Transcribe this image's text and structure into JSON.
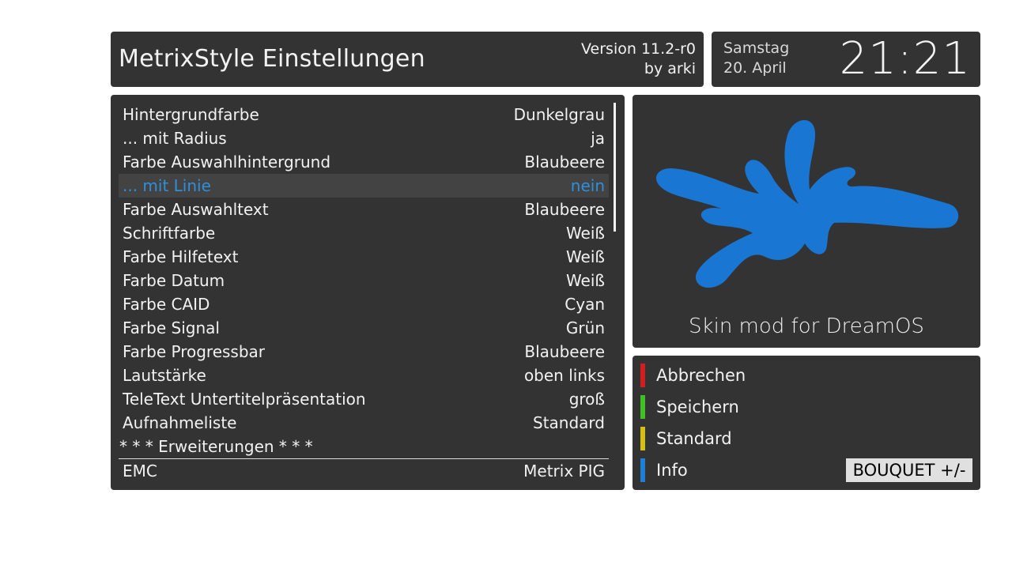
{
  "header": {
    "title": "MetrixStyle Einstellungen",
    "version": "Version 11.2-r0",
    "author": "by arki"
  },
  "clock": {
    "weekday": "Samstag",
    "date": "20. April",
    "time": "21:21"
  },
  "settings": [
    {
      "label": "Hintergrundfarbe",
      "value": "Dunkelgrau"
    },
    {
      "label": "... mit Radius",
      "value": "ja"
    },
    {
      "label": "Farbe Auswahlhintergrund",
      "value": "Blaubeere"
    },
    {
      "label": "... mit Linie",
      "value": "nein",
      "selected": true
    },
    {
      "label": "Farbe Auswahltext",
      "value": "Blaubeere"
    },
    {
      "label": "Schriftfarbe",
      "value": "Weiß"
    },
    {
      "label": "Farbe Hilfetext",
      "value": "Weiß"
    },
    {
      "label": "Farbe Datum",
      "value": "Weiß"
    },
    {
      "label": "Farbe CAID",
      "value": "Cyan"
    },
    {
      "label": "Farbe Signal",
      "value": "Grün"
    },
    {
      "label": "Farbe Progressbar",
      "value": "Blaubeere"
    },
    {
      "label": "Lautstärke",
      "value": "oben links"
    },
    {
      "label": "TeleText Untertitelpräsentation",
      "value": "groß"
    },
    {
      "label": "Aufnahmeliste",
      "value": "Standard"
    },
    {
      "label": "* * * Erweiterungen * * *",
      "value": "",
      "section": true
    },
    {
      "label": "EMC",
      "value": "Metrix PIG"
    }
  ],
  "preview": {
    "caption": "Skin mod for DreamOS",
    "logo_icon": "splash-logo-icon",
    "logo_color": "#1976d2"
  },
  "buttons": [
    {
      "label": "Abbrechen",
      "color": "#d11f1f",
      "icon": "red-key"
    },
    {
      "label": "Speichern",
      "color": "#3fbf23",
      "icon": "green-key"
    },
    {
      "label": "Standard",
      "color": "#d4bf1a",
      "icon": "yellow-key"
    },
    {
      "label": "Info",
      "color": "#1e7fd6",
      "icon": "blue-key"
    }
  ],
  "bouquet_label": "BOUQUET +/-",
  "colors": {
    "panel": "#333333",
    "selected_text": "#2e8fdb",
    "selected_bg": "#434343"
  }
}
